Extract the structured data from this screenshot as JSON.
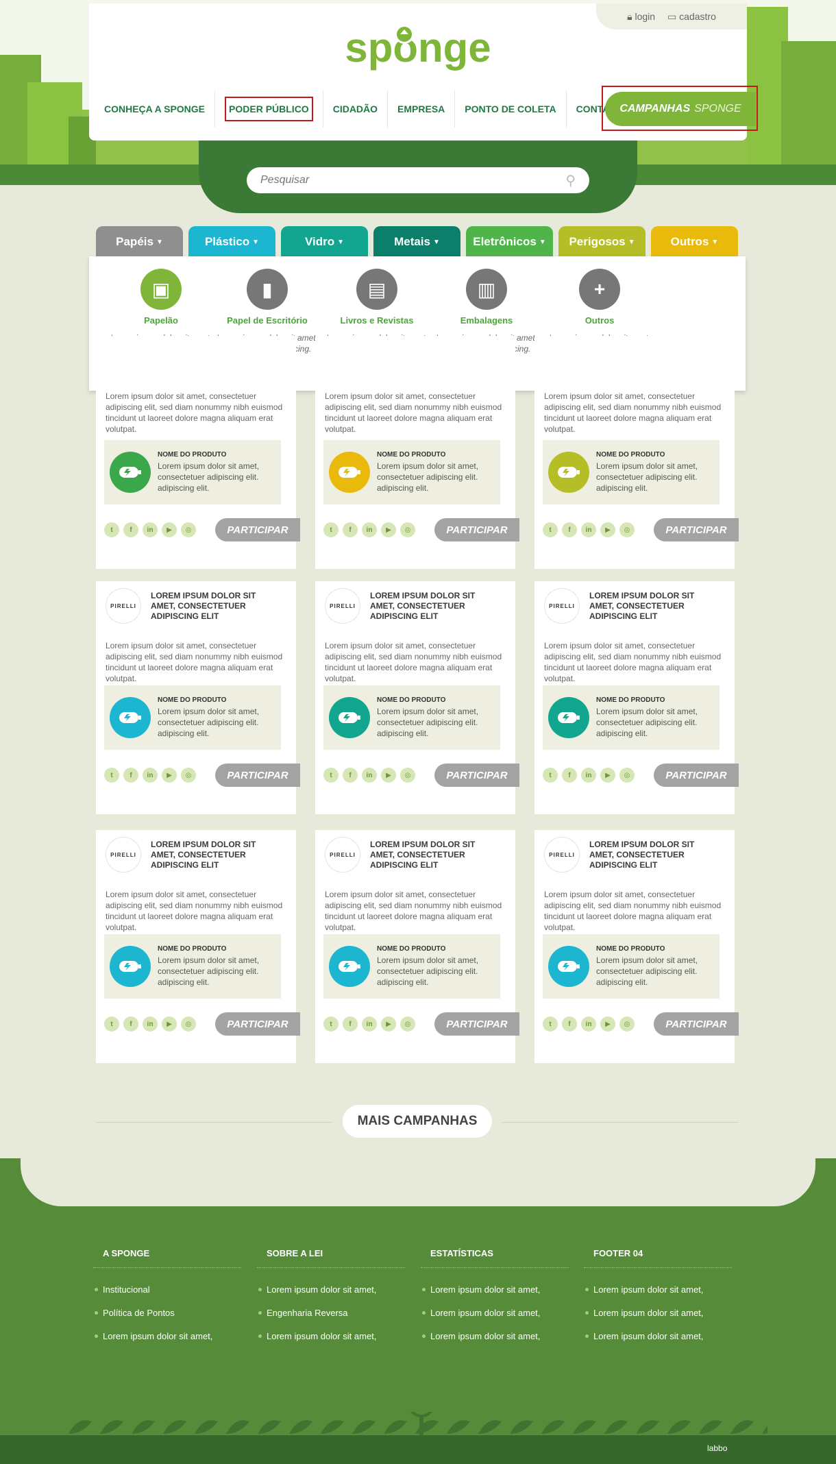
{
  "header": {
    "login_label": "login",
    "cadastro_label": "cadastro",
    "logo_text": "sponge",
    "nav": [
      "CONHEÇA A SPONGE",
      "PODER PÚBLICO",
      "CIDADÃO",
      "EMPRESA",
      "PONTO DE COLETA",
      "CONTATO"
    ],
    "campaign_button": {
      "bold": "CAMPANHAS",
      "light": "SPONGE"
    }
  },
  "search": {
    "placeholder": "Pesquisar"
  },
  "tabs": [
    {
      "label": "Papéis",
      "color": "#8f8f8f"
    },
    {
      "label": "Plástico",
      "color": "#1db6d0"
    },
    {
      "label": "Vidro",
      "color": "#12a58f"
    },
    {
      "label": "Metais",
      "color": "#0c7f6a"
    },
    {
      "label": "Eletrônicos",
      "color": "#4fb54b"
    },
    {
      "label": "Perigosos",
      "color": "#b5be27"
    },
    {
      "label": "Outros",
      "color": "#e9b90c"
    }
  ],
  "dropdown": [
    {
      "name": "Papelão",
      "desc": "Lorem ipsum dolor sit amet, consectetuer adipiscing.",
      "icon": "box-icon"
    },
    {
      "name": "Papel de Escritório",
      "desc": "Lorem ipsum dolor sit amet, consectetuer adipiscing.",
      "icon": "paper-icon"
    },
    {
      "name": "Livros e Revistas",
      "desc": "Lorem ipsum dolor sit amet, consectetuer adipiscing.",
      "icon": "book-icon"
    },
    {
      "name": "Embalagens",
      "desc": "Lorem ipsum dolor sit amet, consectetuer adipiscing.",
      "icon": "package-icon"
    },
    {
      "name": "Outros",
      "desc": "Lorem ipsum dolor sit amet, consectetuer adipiscing.",
      "icon": "plus-icon"
    }
  ],
  "card": {
    "brand": "PIRELLI",
    "title": "LOREM IPSUM DOLOR SIT AMET, CONSECTETUER ADIPISCING ELIT",
    "body": "Lorem ipsum dolor sit amet, consectetuer adipiscing elit, sed diam nonummy nibh euismod tincidunt ut laoreet dolore magna aliquam erat volutpat.",
    "product_name": "NOME DO PRODUTO",
    "product_desc": "Lorem ipsum dolor sit amet, consectetuer adipiscing elit. adipiscing elit.",
    "social": [
      "twitter-icon",
      "facebook-icon",
      "linkedin-icon",
      "youtube-icon",
      "instagram-icon"
    ],
    "button": "PARTICIPAR"
  },
  "cards": [
    {
      "product_color": "#3aa84a"
    },
    {
      "product_color": "#e9b90c"
    },
    {
      "product_color": "#b5be27"
    },
    {
      "product_color": "#1db6d0"
    },
    {
      "product_color": "#12a58f"
    },
    {
      "product_color": "#12a58f"
    },
    {
      "product_color": "#1db6d0"
    },
    {
      "product_color": "#1db6d0"
    },
    {
      "product_color": "#1db6d0"
    }
  ],
  "more_campaigns": "MAIS CAMPANHAS",
  "footer": {
    "columns": [
      {
        "title": "A SPONGE",
        "items": [
          "Institucional",
          "Política de Pontos",
          "Lorem ipsum dolor sit amet,"
        ]
      },
      {
        "title": "SOBRE A LEI",
        "items": [
          "Lorem ipsum dolor sit amet,",
          "Engenharia Reversa",
          "Lorem ipsum dolor sit amet,"
        ]
      },
      {
        "title": "ESTATÍSTICAS",
        "items": [
          "Lorem ipsum dolor sit amet,",
          "Lorem ipsum dolor sit amet,",
          "Lorem ipsum dolor sit amet,"
        ]
      },
      {
        "title": "FOOTER 04",
        "items": [
          "Lorem ipsum dolor sit amet,",
          "Lorem ipsum dolor sit amet,",
          "Lorem ipsum dolor sit amet,"
        ]
      }
    ],
    "credit": "labbo"
  }
}
